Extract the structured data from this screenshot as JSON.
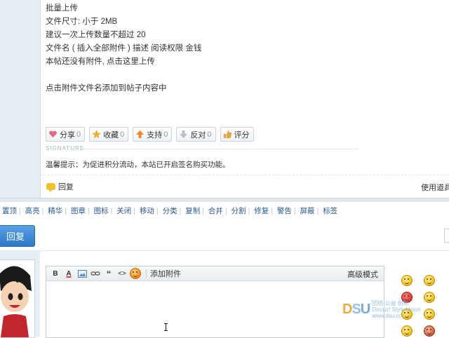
{
  "upload_info": {
    "lines": [
      "批量上传",
      "文件尺寸: 小于 2MB",
      "建议一次上传数量不超过 20",
      "文件名 ( 插入全部附件 ) 描述  阅读权限    金钱",
      "本帖还没有附件, 点击这里上传",
      "",
      "点击附件文件名添加到帖子内容中"
    ]
  },
  "actions": {
    "share": {
      "label": "分享",
      "count": "0"
    },
    "favorite": {
      "label": "收藏",
      "count": "0"
    },
    "support": {
      "label": "支持",
      "count": "0"
    },
    "oppose": {
      "label": "反对",
      "count": "0"
    },
    "rate": {
      "label": "评分"
    }
  },
  "signature_label": "SIGNATURE",
  "tip_text": "温馨提示：为促进积分流动，本站已开启签名购买功能。",
  "reply_link": "回复",
  "use_tools": "使用道具",
  "mod_bar": [
    "置顶",
    "高亮",
    "精华",
    "图章",
    "图标",
    "关闭",
    "移动",
    "分类",
    "复制",
    "合并",
    "分割",
    "修复",
    "警告",
    "屏蔽",
    "标签"
  ],
  "reply_button": "回复",
  "editor": {
    "toolbar": {
      "bold": "B",
      "font_color": "A",
      "quote": "“",
      "code": "<>",
      "attach": "添加附件",
      "advanced": "高级模式"
    }
  },
  "watermark": {
    "logo_d": "D",
    "logo_s": "S",
    "logo_u": "U",
    "text_cn": "团结 公益 创新",
    "text_en": "Discuz! Style Union",
    "url": "www.dsu.cc"
  },
  "colors": {
    "accent": "#2f78c6",
    "link": "#2a5b8e",
    "panel": "#e6eef5"
  }
}
